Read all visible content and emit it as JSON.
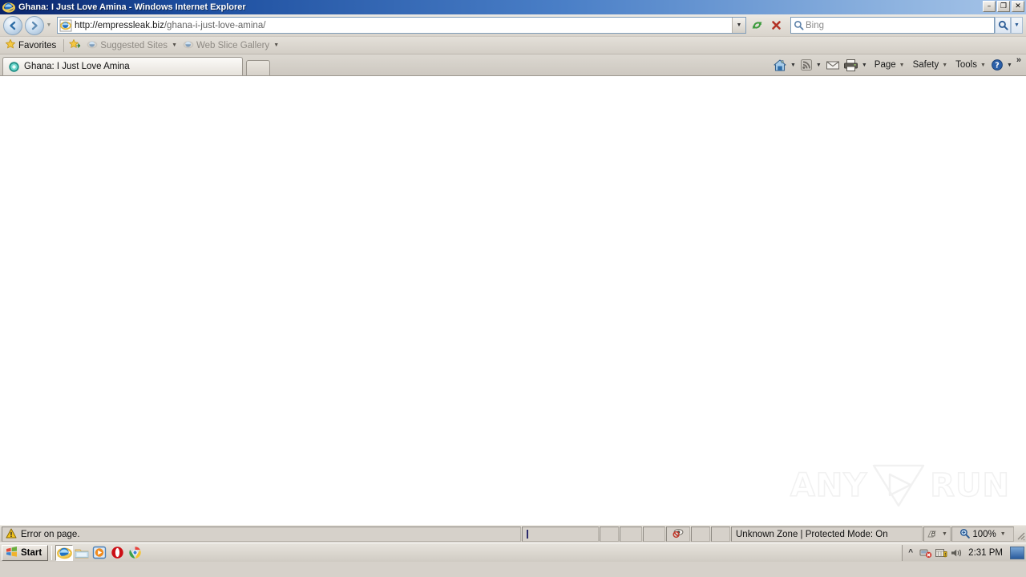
{
  "window": {
    "title": "Ghana: I Just Love Amina - Windows Internet Explorer",
    "icon": "ie-logo-icon",
    "minimize_label": "–",
    "maximize_label": "❐",
    "close_label": "✕"
  },
  "navbar": {
    "back_label": "Back",
    "forward_label": "Forward",
    "recent_pages_label": "Recent Pages",
    "address": {
      "icon": "ie-page-icon",
      "domain": "http://empressleak.biz",
      "path": "/ghana-i-just-love-amina/",
      "full_url": "http://empressleak.biz/ghana-i-just-love-amina/",
      "dropdown_label": "▼"
    },
    "refresh_label": "Refresh",
    "stop_label": "Stop",
    "search": {
      "placeholder": "Bing",
      "value": "",
      "go_label": "Search",
      "options_label": "▼"
    }
  },
  "favorites_bar": {
    "favorites_label": "Favorites",
    "items": [
      {
        "label": "Suggested Sites",
        "icon": "ie-small-icon",
        "dim": true,
        "caret": "▼"
      },
      {
        "label": "Web Slice Gallery",
        "icon": "ie-small-icon",
        "dim": true,
        "caret": "▼"
      }
    ],
    "add_favorite_label": "Add to Favorites Bar"
  },
  "tabs": {
    "items": [
      {
        "label": "Ghana: I Just Love Amina",
        "icon": "site-favicon",
        "active": true
      }
    ],
    "new_tab_label": "New Tab"
  },
  "command_bar": {
    "home_label": "Home",
    "feeds_label": "Feeds",
    "mail_label": "Read Mail",
    "print_label": "Print",
    "page_label": "Page",
    "safety_label": "Safety",
    "tools_label": "Tools",
    "help_label": "Help",
    "overflow_label": "»",
    "caret": "▼"
  },
  "content": {
    "body_text": "",
    "watermark": {
      "left": "ANY",
      "right": "RUN",
      "icon": "play-triangle-icon"
    }
  },
  "status_bar": {
    "error_text": "Error on page.",
    "error_icon": "warning-triangle-icon",
    "popup_blocked_icon": "popup-blocked-icon",
    "zone_text": "Unknown Zone | Protected Mode: On",
    "security_icon": "lock-icon",
    "security_caret": "▼",
    "zoom_icon": "zoom-in-icon",
    "zoom_level": "100%",
    "zoom_caret": "▼"
  },
  "taskbar": {
    "start_label": "Start",
    "start_icon": "windows-flag-icon",
    "quick_launch": [
      {
        "name": "internet-explorer",
        "active": true
      },
      {
        "name": "windows-explorer",
        "active": false
      },
      {
        "name": "media-player",
        "active": false
      },
      {
        "name": "opera-browser",
        "active": false
      },
      {
        "name": "google-chrome",
        "active": false
      }
    ],
    "tray": {
      "expand_label": "«",
      "network_icon": "network-disconnected-icon",
      "security_icon": "security-alert-icon",
      "volume_icon": "volume-icon",
      "time": "2:31 PM",
      "show_desktop_label": "Show Desktop"
    }
  },
  "colors": {
    "titlebar_start": "#0a246a",
    "titlebar_end": "#a8c5e8",
    "toolbar_bg": "#d6d1ca",
    "content_bg": "#ffffff",
    "address_border": "#7f9db9",
    "error_yellow": "#f5c518",
    "stop_red": "#c0392b",
    "refresh_green": "#3a9a3a"
  }
}
